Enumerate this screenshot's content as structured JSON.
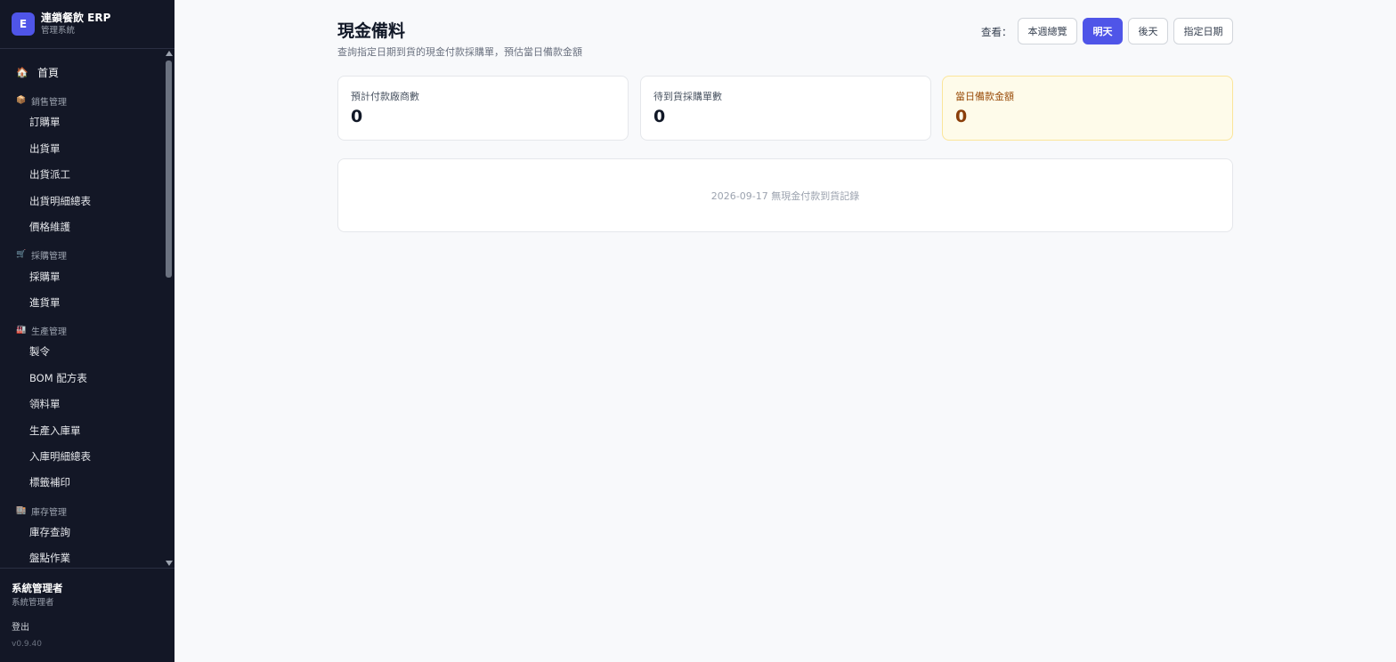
{
  "brand": {
    "logo_letter": "E",
    "title": "連鎖餐飲 ERP",
    "subtitle": "管理系統",
    "accent": "#4f55e8"
  },
  "sidebar": {
    "home": {
      "icon": "home-icon",
      "label": "首頁"
    },
    "groups": [
      {
        "icon": "package-icon",
        "label": "銷售管理",
        "items": [
          "訂購單",
          "出貨單",
          "出貨派工",
          "出貨明細總表",
          "價格維護"
        ]
      },
      {
        "icon": "cart-icon",
        "label": "採購管理",
        "items": [
          "採購單",
          "進貨單"
        ]
      },
      {
        "icon": "factory-icon",
        "label": "生產管理",
        "items": [
          "製令",
          "BOM 配方表",
          "領料單",
          "生產入庫單",
          "入庫明細總表",
          "標籤補印"
        ]
      },
      {
        "icon": "warehouse-icon",
        "label": "庫存管理",
        "items": [
          "庫存查詢",
          "盤點作業"
        ]
      }
    ]
  },
  "user": {
    "name": "系統管理者",
    "role": "系統管理者",
    "logout": "登出",
    "version": "v0.9.40"
  },
  "header": {
    "title": "現金備料",
    "subtitle": "查詢指定日期到貨的現金付款採購單，預估當日備款金額",
    "view_label": "查看：",
    "buttons": [
      "本週總覽",
      "明天",
      "後天",
      "指定日期"
    ],
    "active_button": "明天"
  },
  "stats": [
    {
      "label": "預計付款廠商數",
      "value": "0"
    },
    {
      "label": "待到貨採購單數",
      "value": "0"
    },
    {
      "label": "當日備款金額",
      "value": "0",
      "highlight_color": "#fefbea"
    }
  ],
  "empty_message": "2026-09-17 無現金付款到貨記錄"
}
